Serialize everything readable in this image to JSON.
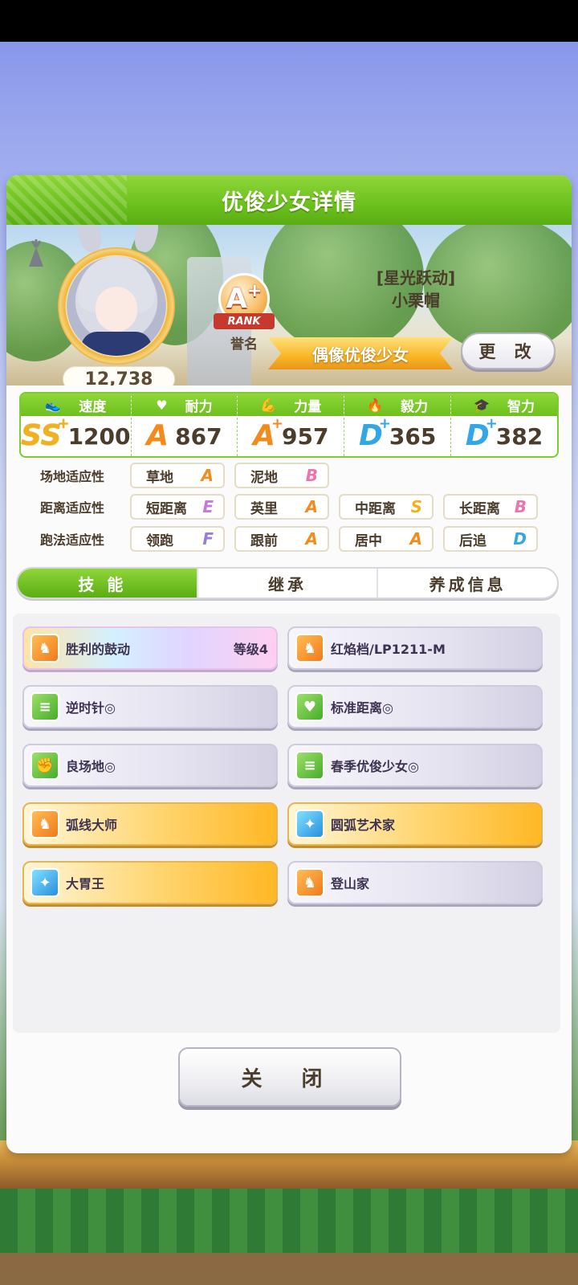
{
  "dialog": {
    "title": "优俊少女详情",
    "fans": "12,738",
    "rank": {
      "letter": "A",
      "plus": "+",
      "ribbon": "RANK",
      "label": "誉名"
    },
    "horse_title": "[星光跃动]",
    "horse_name": "小栗帽",
    "epithet": "偶像优俊少女",
    "change_label": "更 改"
  },
  "stats": [
    {
      "name": "速度",
      "icon": "shoe-icon",
      "grade": "SS",
      "plus": "+",
      "value": "1200",
      "color": "#f0b21c"
    },
    {
      "name": "耐力",
      "icon": "heart-icon",
      "grade": "A",
      "plus": "",
      "value": "867",
      "color": "#f28a1c"
    },
    {
      "name": "力量",
      "icon": "muscle-icon",
      "grade": "A",
      "plus": "+",
      "value": "957",
      "color": "#f28a1c"
    },
    {
      "name": "毅力",
      "icon": "flame-icon",
      "grade": "D",
      "plus": "+",
      "value": "365",
      "color": "#32a7e6"
    },
    {
      "name": "智力",
      "icon": "graduation-cap-icon",
      "grade": "D",
      "plus": "+",
      "value": "382",
      "color": "#32a7e6"
    }
  ],
  "aptitudes": {
    "track": {
      "label": "场地适应性",
      "items": [
        {
          "name": "草地",
          "grade": "A"
        },
        {
          "name": "泥地",
          "grade": "B"
        }
      ]
    },
    "distance": {
      "label": "距离适应性",
      "items": [
        {
          "name": "短距离",
          "grade": "E"
        },
        {
          "name": "英里",
          "grade": "A"
        },
        {
          "name": "中距离",
          "grade": "S"
        },
        {
          "name": "长距离",
          "grade": "B"
        }
      ]
    },
    "style": {
      "label": "跑法适应性",
      "items": [
        {
          "name": "领跑",
          "grade": "F"
        },
        {
          "name": "跟前",
          "grade": "A"
        },
        {
          "name": "居中",
          "grade": "A"
        },
        {
          "name": "后追",
          "grade": "D"
        }
      ]
    }
  },
  "tabs": [
    "技能",
    "继承",
    "养成信息"
  ],
  "skills": [
    {
      "name": "胜利的鼓动",
      "level": "等级4",
      "style": "rainbow",
      "icon": "horse-rider-icon"
    },
    {
      "name": "红焰档/LP1211-M",
      "level": "",
      "style": "normal",
      "icon": "horse-rider-icon"
    },
    {
      "name": "逆时针◎",
      "level": "",
      "style": "normal",
      "icon": "document-icon"
    },
    {
      "name": "标准距离◎",
      "level": "",
      "style": "normal",
      "icon": "heart-icon"
    },
    {
      "name": "良场地◎",
      "level": "",
      "style": "normal",
      "icon": "muscle-icon"
    },
    {
      "name": "春季优俊少女◎",
      "level": "",
      "style": "normal",
      "icon": "document-icon"
    },
    {
      "name": "弧线大师",
      "level": "",
      "style": "gold",
      "icon": "horse-rider-icon"
    },
    {
      "name": "圆弧艺术家",
      "level": "",
      "style": "gold",
      "icon": "sparkle-icon"
    },
    {
      "name": "大胃王",
      "level": "",
      "style": "gold",
      "icon": "sparkle-icon"
    },
    {
      "name": "登山家",
      "level": "",
      "style": "normal",
      "icon": "horse-rider-icon"
    }
  ],
  "close_label": "关 闭"
}
